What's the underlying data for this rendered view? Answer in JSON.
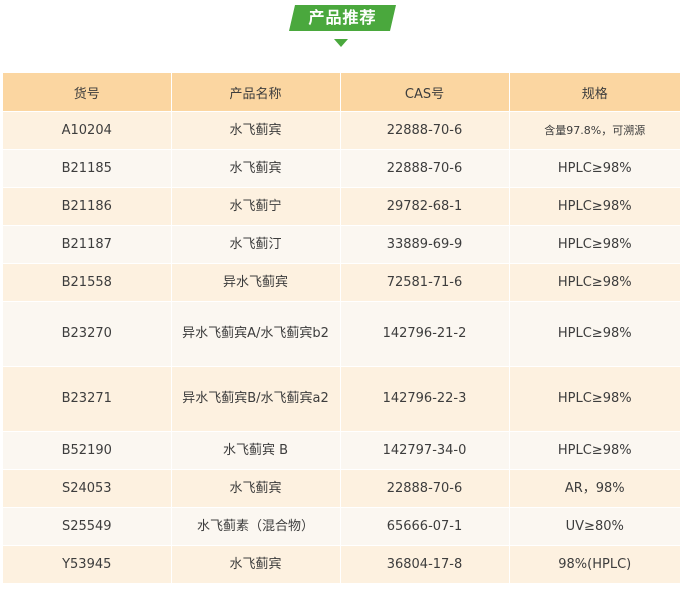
{
  "header": {
    "title": "产品推荐",
    "accent_color": "#4aa83d",
    "table_header_color": "#fbd6a1"
  },
  "table": {
    "columns": [
      "货号",
      "产品名称",
      "CAS号",
      "规格"
    ],
    "rows": [
      [
        "A10204",
        "水飞蓟宾",
        "22888-70-6",
        "含量97.8%，可溯源"
      ],
      [
        "B21185",
        "水飞蓟宾",
        "22888-70-6",
        "HPLC≥98%"
      ],
      [
        "B21186",
        "水飞蓟宁",
        "29782-68-1",
        "HPLC≥98%"
      ],
      [
        "B21187",
        "水飞蓟汀",
        "33889-69-9",
        "HPLC≥98%"
      ],
      [
        "B21558",
        "异水飞蓟宾",
        "72581-71-6",
        "HPLC≥98%"
      ],
      [
        "B23270",
        "异水飞蓟宾A/水飞蓟宾b2",
        "142796-21-2",
        "HPLC≥98%"
      ],
      [
        "B23271",
        "异水飞蓟宾B/水飞蓟宾a2",
        "142796-22-3",
        "HPLC≥98%"
      ],
      [
        "B52190",
        "水飞蓟宾 B",
        "142797-34-0",
        "HPLC≥98%"
      ],
      [
        "S24053",
        "水飞蓟宾",
        "22888-70-6",
        "AR，98%"
      ],
      [
        "S25549",
        "水飞蓟素（混合物）",
        "65666-07-1",
        "UV≥80%"
      ],
      [
        "Y53945",
        "水飞蓟宾",
        "36804-17-8",
        "98%(HPLC)"
      ]
    ]
  }
}
